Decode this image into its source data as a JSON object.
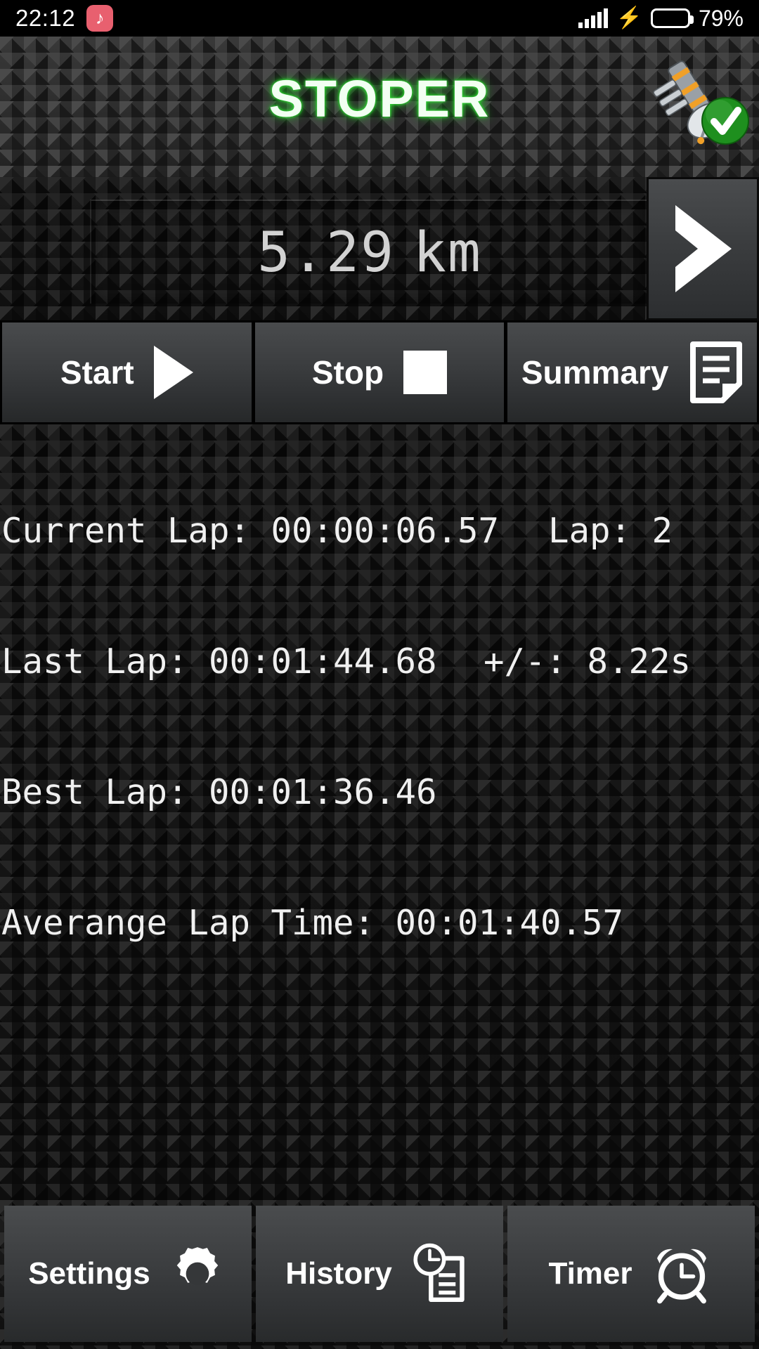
{
  "status_bar": {
    "time": "22:12",
    "app_icon": "music-note-icon",
    "signal_icon": "signal-bars-icon",
    "charging_icon": "charging-bolt-icon",
    "battery_icon": "battery-icon",
    "battery_percent": "79%",
    "battery_level": 79,
    "battery_color": "#35c13a",
    "app_icon_color": "#e8606f"
  },
  "header": {
    "title": "STOPER",
    "title_glow_color": "#2fdc32",
    "gps_icon": "gps-satellite-icon",
    "gps_status_icon": "green-check-badge-icon"
  },
  "distance": {
    "value": "5.29",
    "unit": "km",
    "next_icon": "chevron-right-icon"
  },
  "controls": [
    {
      "label": "Start",
      "icon": "play-icon"
    },
    {
      "label": "Stop",
      "icon": "stop-square-icon"
    },
    {
      "label": "Summary",
      "icon": "document-list-icon"
    }
  ],
  "stats": [
    {
      "label": "Current Lap:",
      "value": "00:00:06.57",
      "extra_label": "Lap:",
      "extra_value": "2"
    },
    {
      "label": "Last Lap:",
      "value": "00:01:44.68",
      "extra_label": "+/-:",
      "extra_value": "8.22s"
    },
    {
      "label": "Best Lap:",
      "value": "00:01:36.46",
      "extra_label": "",
      "extra_value": ""
    },
    {
      "label": "Averange Lap Time:",
      "value": "00:01:40.57",
      "extra_label": "",
      "extra_value": ""
    }
  ],
  "stats_text": {
    "current_lap": "Current Lap: 00:00:06.57",
    "current_lap_counter": "Lap: 2",
    "last_lap": "Last Lap: 00:01:44.68",
    "last_lap_delta": "+/-: 8.22s",
    "best_lap": "Best Lap: 00:01:36.46",
    "average_lap": "Averange Lap Time: 00:01:40.57"
  },
  "bottom_nav": [
    {
      "label": "Settings",
      "icon": "gear-icon"
    },
    {
      "label": "History",
      "icon": "clock-document-icon"
    },
    {
      "label": "Timer",
      "icon": "alarm-clock-icon"
    }
  ]
}
